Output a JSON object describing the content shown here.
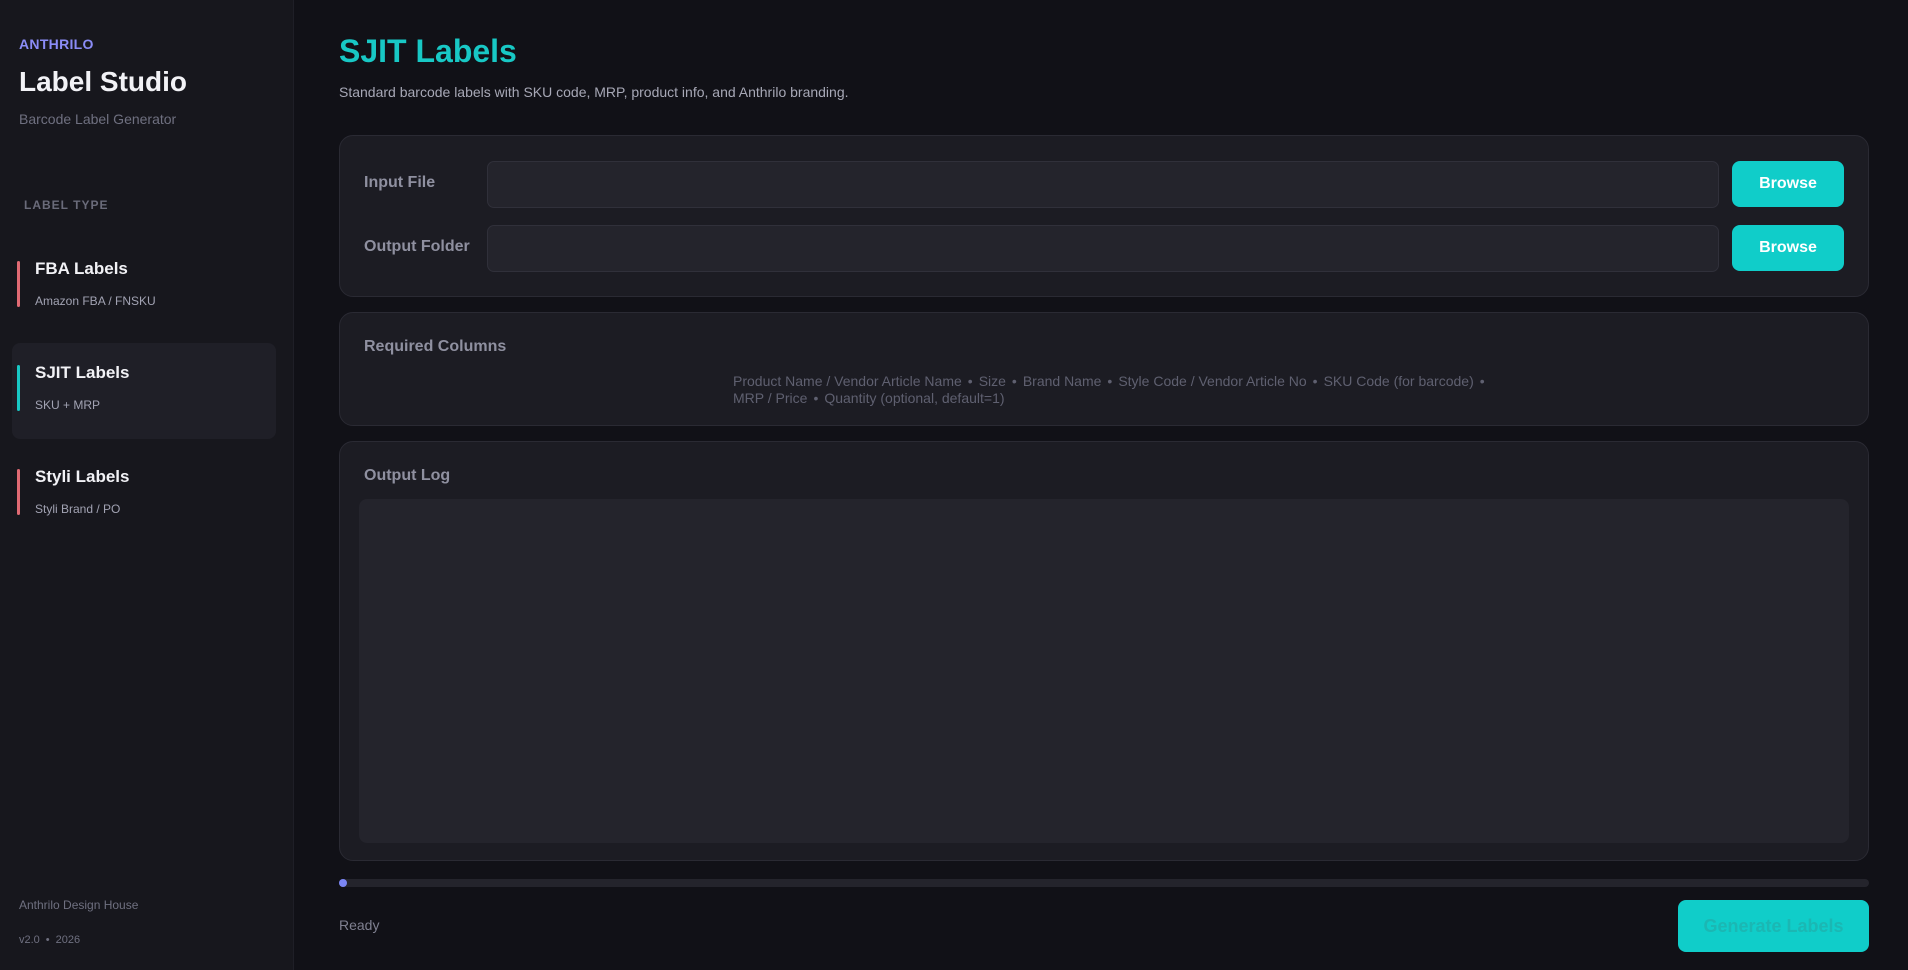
{
  "sidebar": {
    "eyebrow": "ANTHRILO",
    "title": "Label Studio",
    "subtitle": "Barcode Label Generator",
    "section_label": "LABEL TYPE",
    "items": [
      {
        "title": "FBA Labels",
        "subtitle": "Amazon FBA / FNSKU",
        "accent": "#e06a73",
        "active": false
      },
      {
        "title": "SJIT Labels",
        "subtitle": "SKU + MRP",
        "accent": "#18c8c5",
        "active": true
      },
      {
        "title": "Styli Labels",
        "subtitle": "Styli Brand / PO",
        "accent": "#e06a73",
        "active": false
      }
    ],
    "footer_company": "Anthrilo Design House",
    "footer_version": "v2.0",
    "footer_year": "2026"
  },
  "main": {
    "title": "SJIT Labels",
    "subtitle": "Standard barcode labels with SKU code, MRP, product info, and Anthrilo branding.",
    "input_file": {
      "label": "Input File",
      "value": "",
      "button": "Browse"
    },
    "output_folder": {
      "label": "Output Folder",
      "value": "",
      "button": "Browse"
    },
    "required_columns": {
      "title": "Required Columns",
      "line1": [
        "Product Name / Vendor Article Name",
        "Size",
        "Brand Name",
        "Style Code / Vendor Article No",
        "SKU Code (for barcode)"
      ],
      "line2": [
        "MRP / Price",
        "Quantity (optional, default=1)"
      ]
    },
    "output_log": {
      "title": "Output Log",
      "content": ""
    },
    "progress": 0.005,
    "status": "Ready",
    "generate_button": "Generate Labels"
  },
  "colors": {
    "accent": "#10cdc9",
    "title_accent": "#18c8c5",
    "brand": "#8b8cf7",
    "inactive_accent": "#e06a73",
    "progress": "#7b86f5"
  }
}
